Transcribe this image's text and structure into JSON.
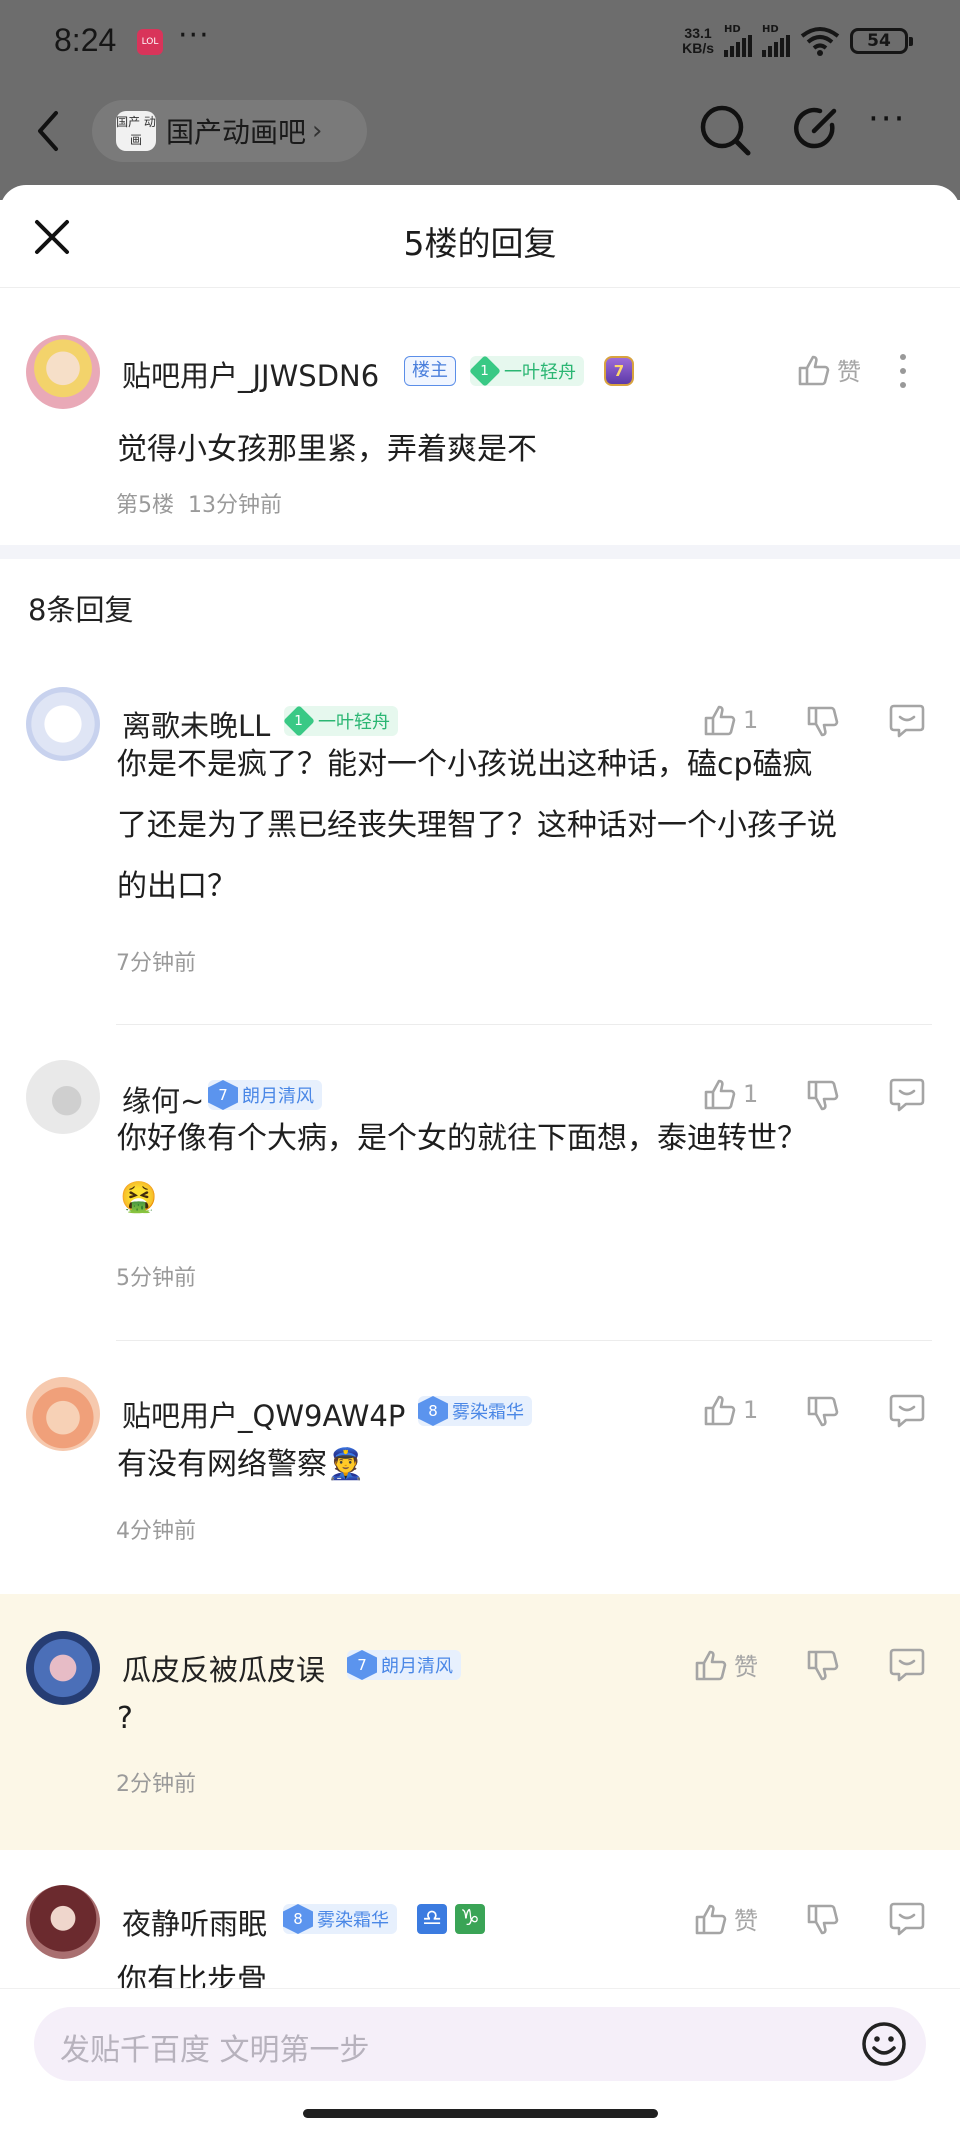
{
  "status_bar": {
    "time": "8:24",
    "app_badge": "LOL",
    "more": "···",
    "net_speed_value": "33.1",
    "net_speed_unit": "KB/s",
    "signal1_label": "HD",
    "signal2_label": "HD",
    "battery": "54"
  },
  "nav": {
    "forum_logo_text": "国产 动画",
    "forum_name": "国产动画吧",
    "chevron": "›",
    "more": "···"
  },
  "sheet": {
    "title": "5楼的回复"
  },
  "original_post": {
    "username": "贴吧用户_JJWSDN6",
    "owner_tag": "楼主",
    "badge_level": "1",
    "badge_name": "一叶轻舟",
    "member_level": "7",
    "like_label": "赞",
    "content": "觉得小女孩那里紧，弄着爽是不",
    "floor": "第5楼",
    "time": "13分钟前"
  },
  "reply_count": "8条回复",
  "replies": [
    {
      "username": "离歌未晚LL",
      "badge_level": "1",
      "badge_name": "一叶轻舟",
      "badge_style": "green",
      "likes": "1",
      "content_lines": [
        "你是不是疯了？能对一个小孩说出这种话，磕cp磕疯",
        "了还是为了黑已经丧失理智了？这种话对一个小孩子说",
        "的出口？"
      ],
      "time": "7分钟前"
    },
    {
      "username": "缘何~",
      "badge_level": "7",
      "badge_name": "朗月清风",
      "badge_style": "blue",
      "likes": "1",
      "content_lines": [
        "你好像有个大病，是个女的就往下面想，泰迪转世？"
      ],
      "emoji": "🤮",
      "time": "5分钟前"
    },
    {
      "username": "贴吧用户_QW9AW4P",
      "badge_level": "8",
      "badge_name": "雾染霜华",
      "badge_style": "blue",
      "likes": "1",
      "content_lines": [
        "有没有网络警察👮"
      ],
      "time": "4分钟前"
    },
    {
      "username": "瓜皮反被瓜皮误",
      "badge_level": "7",
      "badge_name": "朗月清风",
      "badge_style": "blue",
      "likes": "赞",
      "content_lines": [
        "?"
      ],
      "time": "2分钟前"
    },
    {
      "username": "夜静听雨眠",
      "badge_level": "8",
      "badge_name": "雾染霜华",
      "badge_style": "blue",
      "zodiac1": "♎",
      "zodiac2": "♑",
      "likes": "赞",
      "content_lines": [
        "你有比步骨"
      ],
      "time": ""
    }
  ],
  "composer": {
    "placeholder": "发贴千百度 文明第一步"
  },
  "colors": {
    "dim_background": "#6d6d6d",
    "highlight_row": "#fcf7e7",
    "green_badge": "#39c985",
    "blue_badge": "#5b94ee",
    "owner_tag": "#5b8ee8"
  }
}
